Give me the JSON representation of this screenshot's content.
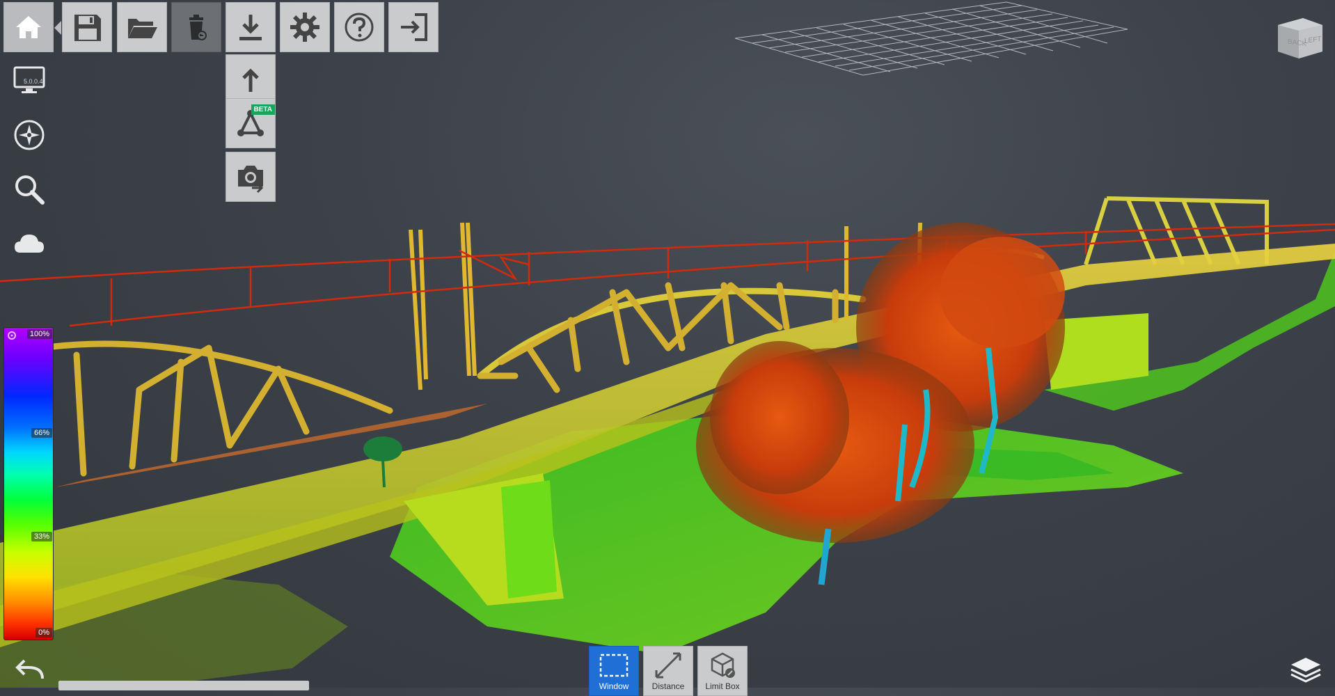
{
  "toolbar": {
    "buttons": [
      {
        "name": "home",
        "icon": "home-icon"
      },
      {
        "name": "save",
        "icon": "save-icon"
      },
      {
        "name": "open",
        "icon": "folder-open-icon"
      },
      {
        "name": "delete",
        "icon": "trash-icon"
      },
      {
        "name": "import",
        "icon": "download-icon"
      },
      {
        "name": "settings",
        "icon": "gear-icon"
      },
      {
        "name": "help",
        "icon": "help-icon"
      },
      {
        "name": "exit",
        "icon": "exit-icon"
      }
    ],
    "submenu": [
      {
        "name": "export",
        "icon": "upload-icon"
      },
      {
        "name": "mesh",
        "icon": "mesh-icon",
        "badge": "BETA"
      },
      {
        "name": "snapshot",
        "icon": "camera-export-icon"
      }
    ]
  },
  "sidebar": {
    "version": "5.0.0.4",
    "items": [
      "monitor-icon",
      "compass-icon",
      "search-icon",
      "cloud-icon"
    ]
  },
  "scale": {
    "labels": {
      "top": "100%",
      "mid_high": "66%",
      "mid_low": "33%",
      "bottom": "0%"
    }
  },
  "navcube": {
    "back": "BACK",
    "left": "LEFT"
  },
  "bottom_tools": [
    {
      "label": "Window",
      "icon": "window-select-icon",
      "active": true
    },
    {
      "label": "Distance",
      "icon": "distance-icon",
      "active": false
    },
    {
      "label": "Limit Box",
      "icon": "limit-box-icon",
      "active": false
    }
  ],
  "colors": {
    "active_tool": "#1f6fd6",
    "toolbar_bg": "#c9cbcd",
    "background": "#3d424a"
  }
}
